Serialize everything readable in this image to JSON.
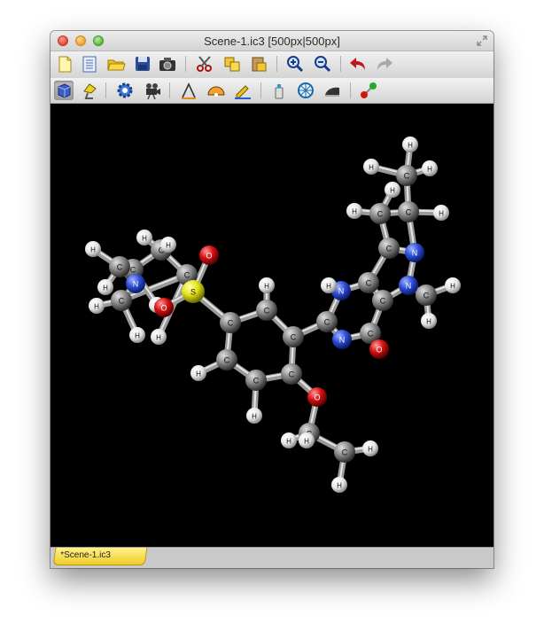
{
  "window": {
    "title": "Scene-1.ic3 [500px|500px]"
  },
  "toolbar_row1": [
    {
      "name": "new-document-icon"
    },
    {
      "name": "document-list-icon"
    },
    {
      "name": "open-folder-icon"
    },
    {
      "name": "save-icon"
    },
    {
      "name": "camera-icon"
    },
    {
      "name": "scissors-icon"
    },
    {
      "name": "copy-boxes-icon"
    },
    {
      "name": "paste-box-icon"
    },
    {
      "name": "zoom-in-icon"
    },
    {
      "name": "zoom-out-icon"
    },
    {
      "name": "undo-icon"
    },
    {
      "name": "redo-icon"
    }
  ],
  "toolbar_row2": [
    {
      "name": "rotate-cube-icon"
    },
    {
      "name": "lamp-icon"
    },
    {
      "name": "gear-icon"
    },
    {
      "name": "movie-camera-icon"
    },
    {
      "name": "angle-tool-icon"
    },
    {
      "name": "protractor-icon"
    },
    {
      "name": "pen-icon"
    },
    {
      "name": "spray-can-icon"
    },
    {
      "name": "compass-icon"
    },
    {
      "name": "iron-icon"
    },
    {
      "name": "bond-tool-icon"
    }
  ],
  "tab": {
    "label": "*Scene-1.ic3"
  },
  "colors": {
    "carbon": "#8a8a8a",
    "hydrogen": "#f2f2f2",
    "nitrogen": "#2f4fd8",
    "oxygen": "#d81010",
    "sulfur": "#e4e41a",
    "tab": "#f3d33a"
  },
  "atom_labels": {
    "C": "C",
    "H": "H",
    "N": "N",
    "O": "O",
    "S": "S"
  }
}
